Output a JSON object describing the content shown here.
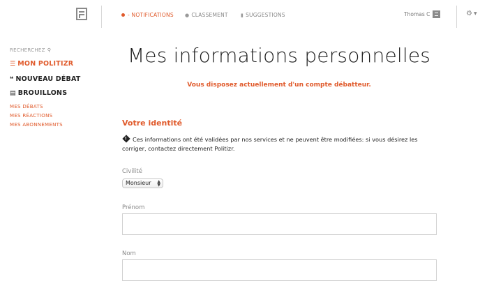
{
  "nav": {
    "notifications": "NOTIFICATIONS",
    "notifications_prefix": "-",
    "classement": "CLASSEMENT",
    "suggestions": "SUGGESTIONS"
  },
  "user": {
    "name": "Thomas C"
  },
  "sidebar": {
    "search": "RECHERCHEZ",
    "items": [
      {
        "label": "MON POLITIZR",
        "icon": "list-icon"
      },
      {
        "label": "NOUVEAU DÉBAT",
        "icon": "quote-icon"
      },
      {
        "label": "BROUILLONS",
        "icon": "draft-icon"
      }
    ],
    "subitems": [
      "MES DÉBATS",
      "MES RÉACTIONS",
      "MES ABONNEMENTS"
    ]
  },
  "main": {
    "title": "Mes informations personnelles",
    "status": "Vous disposez actuellement d'un compte débatteur.",
    "section_title": "Votre identité",
    "info": "Ces informations ont été validées par nos services et ne peuvent être modifiées: si vous désirez les corriger, contactez directement Politizr.",
    "fields": {
      "civilite_label": "Civilité",
      "civilite_value": "Monsieur",
      "prenom_label": "Prénom",
      "prenom_value": "",
      "nom_label": "Nom",
      "nom_value": ""
    }
  },
  "colors": {
    "accent": "#e05a2b",
    "text": "#222222",
    "muted": "#888888"
  }
}
